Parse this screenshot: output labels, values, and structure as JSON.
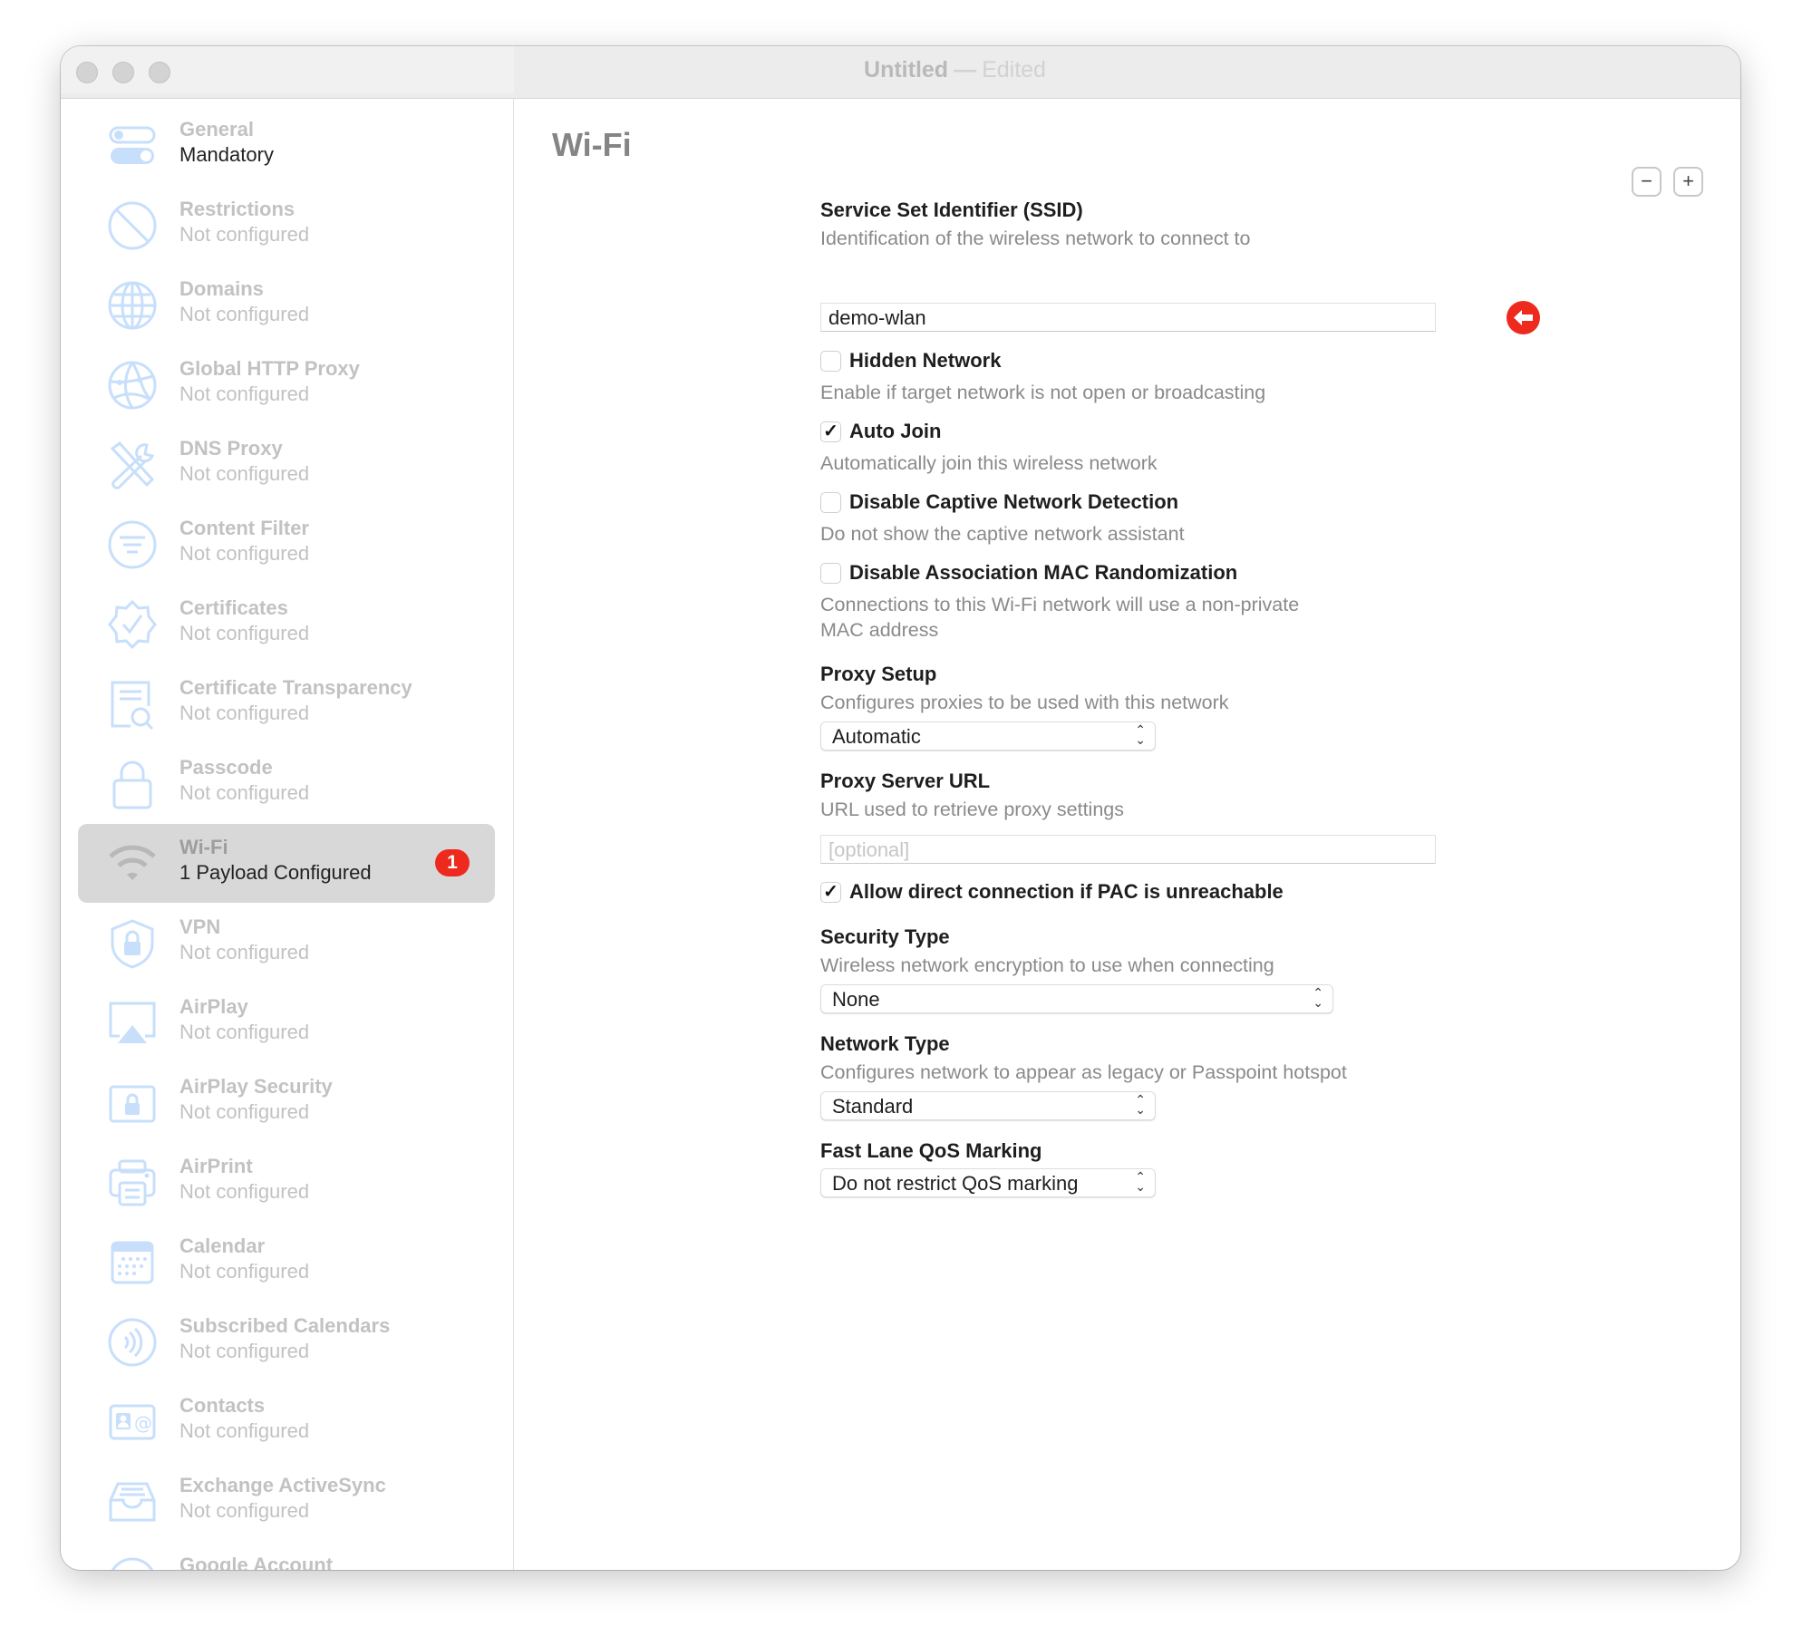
{
  "window": {
    "title": "Untitled",
    "separator": "—",
    "status": "Edited"
  },
  "sidebar": {
    "items": [
      {
        "title": "General",
        "subtitle": "Mandatory",
        "icon": "toggle-switches-icon",
        "state": "active"
      },
      {
        "title": "Restrictions",
        "subtitle": "Not configured",
        "icon": "prohibited-icon"
      },
      {
        "title": "Domains",
        "subtitle": "Not configured",
        "icon": "globe-icon"
      },
      {
        "title": "Global HTTP Proxy",
        "subtitle": "Not configured",
        "icon": "globe-network-icon"
      },
      {
        "title": "DNS Proxy",
        "subtitle": "Not configured",
        "icon": "tools-icon"
      },
      {
        "title": "Content Filter",
        "subtitle": "Not configured",
        "icon": "filter-icon"
      },
      {
        "title": "Certificates",
        "subtitle": "Not configured",
        "icon": "certificate-badge-icon"
      },
      {
        "title": "Certificate Transparency",
        "subtitle": "Not configured",
        "icon": "document-search-icon"
      },
      {
        "title": "Passcode",
        "subtitle": "Not configured",
        "icon": "lock-icon"
      },
      {
        "title": "Wi-Fi",
        "subtitle": "1 Payload Configured",
        "icon": "wifi-icon",
        "state": "selected",
        "badge": "1"
      },
      {
        "title": "VPN",
        "subtitle": "Not configured",
        "icon": "shield-lock-icon"
      },
      {
        "title": "AirPlay",
        "subtitle": "Not configured",
        "icon": "airplay-icon"
      },
      {
        "title": "AirPlay Security",
        "subtitle": "Not configured",
        "icon": "airplay-lock-icon"
      },
      {
        "title": "AirPrint",
        "subtitle": "Not configured",
        "icon": "printer-icon"
      },
      {
        "title": "Calendar",
        "subtitle": "Not configured",
        "icon": "calendar-icon"
      },
      {
        "title": "Subscribed Calendars",
        "subtitle": "Not configured",
        "icon": "subscription-icon"
      },
      {
        "title": "Contacts",
        "subtitle": "Not configured",
        "icon": "contact-card-icon"
      },
      {
        "title": "Exchange ActiveSync",
        "subtitle": "Not configured",
        "icon": "inbox-tray-icon"
      },
      {
        "title": "Google Account",
        "subtitle": "",
        "icon": "mail-icon"
      }
    ]
  },
  "main": {
    "title": "Wi-Fi",
    "remove_label": "−",
    "add_label": "+",
    "ssid": {
      "label": "Service Set Identifier (SSID)",
      "description": "Identification of the wireless network to connect to",
      "value": "demo-wlan",
      "warning_icon": "required-arrow-icon"
    },
    "hidden_network": {
      "label": "Hidden Network",
      "description": "Enable if target network is not open or broadcasting",
      "checked": false
    },
    "auto_join": {
      "label": "Auto Join",
      "description": "Automatically join this wireless network",
      "checked": true
    },
    "captive": {
      "label": "Disable Captive Network Detection",
      "description": "Do not show the captive network assistant",
      "checked": false
    },
    "mac_randomization": {
      "label": "Disable Association MAC Randomization",
      "description_line1": "Connections to this Wi-Fi network will use a non-private",
      "description_line2": "MAC address",
      "checked": false
    },
    "proxy_setup": {
      "label": "Proxy Setup",
      "description": "Configures proxies to be used with this network",
      "value": "Automatic"
    },
    "proxy_url": {
      "label": "Proxy Server URL",
      "description": "URL used to retrieve proxy settings",
      "value": "",
      "placeholder": "[optional]"
    },
    "allow_direct": {
      "label": "Allow direct connection if PAC is unreachable",
      "checked": true
    },
    "security_type": {
      "label": "Security Type",
      "description": "Wireless network encryption to use when connecting",
      "value": "None"
    },
    "network_type": {
      "label": "Network Type",
      "description": "Configures network to appear as legacy or Passpoint hotspot",
      "value": "Standard"
    },
    "qos": {
      "label": "Fast Lane QoS Marking",
      "value": "Do not restrict QoS marking"
    },
    "check_glyph": "✓",
    "chevron_glyph": "⌃⌄"
  },
  "colors": {
    "accent_icon": "#c7dffb",
    "badge": "#ee2a1f",
    "selection": "#d9d8d9"
  }
}
